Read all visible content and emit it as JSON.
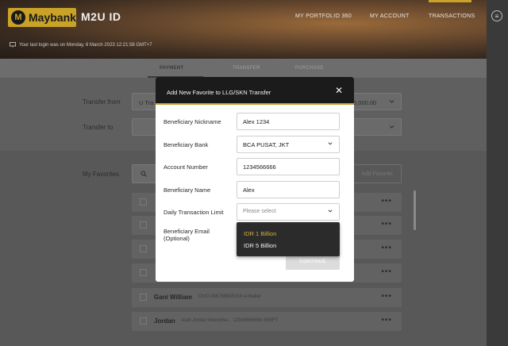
{
  "header": {
    "logo_text": "Maybank",
    "logo_emblem": "M",
    "app_name": "M2U ID",
    "nav": [
      "MY PORTFOLIO 360",
      "MY ACCOUNT",
      "TRANSACTIONS"
    ],
    "last_login": "Your last login was on Monday, 6 March 2023 12:21:58 GMT+7"
  },
  "tabs": [
    {
      "label": "PAYMENT",
      "active": true
    },
    {
      "label": "TRANSFER",
      "active": false
    },
    {
      "label": "PURCHASE",
      "active": false
    }
  ],
  "transfer": {
    "from_label": "Transfer from",
    "from_value": "U Tra",
    "from_amount": "0,000.00",
    "to_label": "Transfer to"
  },
  "favorites": {
    "label": "My Favorites",
    "add_label": "Add Favorite",
    "rows": [
      {
        "name": "Gani William",
        "sub": "OVO 085788545154 e-Wallet"
      },
      {
        "name": "Jordan",
        "sub": "Arab Jordan Investme... 12345666666 SWIFT"
      }
    ]
  },
  "modal": {
    "title": "Add New Favorite to LLG/SKN Transfer",
    "fields": [
      {
        "label": "Beneficiary Nickname",
        "value": "Alex 1234"
      },
      {
        "label": "Beneficiary Bank",
        "value": "BCA PUSAT, JKT"
      },
      {
        "label": "Account Number",
        "value": "1234566666"
      },
      {
        "label": "Beneficiary Name",
        "value": "Alex"
      },
      {
        "label": "Daily Transaction Limit",
        "placeholder": "Please select"
      }
    ],
    "email_label_1": "Beneficiary Email",
    "email_label_2": "(Optional)",
    "dropdown_options": [
      "IDR 1 Billion",
      "IDR 5 Billion"
    ],
    "continue_label": "CONTINUE"
  },
  "colors": {
    "accent": "#c9a227",
    "modal_header": "#1b1b1b",
    "dropdown_bg": "#2b2b2b"
  }
}
